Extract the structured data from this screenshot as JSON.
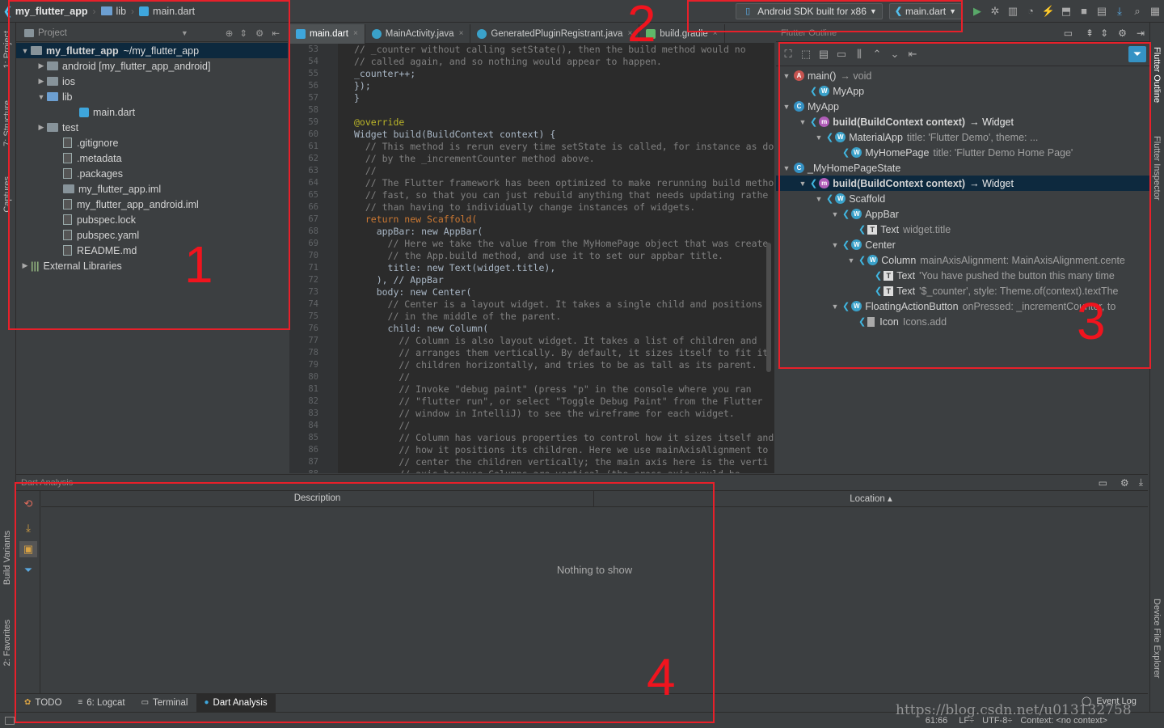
{
  "navbar": {
    "project": "my_flutter_app",
    "folder": "lib",
    "file": "main.dart",
    "device": "Android SDK built for x86",
    "config": "main.dart"
  },
  "project_panel": {
    "header": "Project",
    "tree": [
      {
        "label": "my_flutter_app",
        "detail": "~/my_flutter_app",
        "indent": 0,
        "arrow": "▼",
        "icon": "folder",
        "sel": true
      },
      {
        "label": "android [my_flutter_app_android]",
        "indent": 1,
        "arrow": "▶",
        "icon": "folder"
      },
      {
        "label": "ios",
        "indent": 1,
        "arrow": "▶",
        "icon": "folder"
      },
      {
        "label": "lib",
        "indent": 1,
        "arrow": "▼",
        "icon": "folder-blue"
      },
      {
        "label": "main.dart",
        "indent": 3,
        "arrow": "",
        "icon": "dart"
      },
      {
        "label": "test",
        "indent": 1,
        "arrow": "▶",
        "icon": "folder"
      },
      {
        "label": ".gitignore",
        "indent": 2,
        "arrow": "",
        "icon": "file"
      },
      {
        "label": ".metadata",
        "indent": 2,
        "arrow": "",
        "icon": "file"
      },
      {
        "label": ".packages",
        "indent": 2,
        "arrow": "",
        "icon": "file"
      },
      {
        "label": "my_flutter_app.iml",
        "indent": 2,
        "arrow": "",
        "icon": "folder"
      },
      {
        "label": "my_flutter_app_android.iml",
        "indent": 2,
        "arrow": "",
        "icon": "file"
      },
      {
        "label": "pubspec.lock",
        "indent": 2,
        "arrow": "",
        "icon": "file"
      },
      {
        "label": "pubspec.yaml",
        "indent": 2,
        "arrow": "",
        "icon": "file"
      },
      {
        "label": "README.md",
        "indent": 2,
        "arrow": "",
        "icon": "file"
      },
      {
        "label": "External Libraries",
        "indent": 0,
        "arrow": "▶",
        "icon": "lib"
      }
    ]
  },
  "editor": {
    "tabs": [
      {
        "label": "main.dart",
        "active": true
      },
      {
        "label": "MainActivity.java",
        "active": false
      },
      {
        "label": "GeneratedPluginRegistrant.java",
        "active": false
      },
      {
        "label": "build.gradle",
        "active": false
      }
    ],
    "line_numbers": [
      "53",
      "54",
      "55",
      "56",
      "57",
      "58",
      "59",
      "60",
      "61",
      "62",
      "63",
      "64",
      "65",
      "66",
      "67",
      "68",
      "69",
      "70",
      "71",
      "72",
      "73",
      "74",
      "75",
      "76",
      "77",
      "78",
      "79",
      "80",
      "81",
      "82",
      "83",
      "84",
      "85",
      "86",
      "87",
      "88"
    ],
    "lines": [
      {
        "text": "// _counter without calling setState(), then the build method would no",
        "cls": "comment"
      },
      {
        "text": "// called again, and so nothing would appear to happen.",
        "cls": "comment"
      },
      {
        "text": "_counter++;",
        "cls": ""
      },
      {
        "text": "});",
        "cls": ""
      },
      {
        "text": "}",
        "cls": ""
      },
      {
        "text": "",
        "cls": ""
      },
      {
        "text": "@override",
        "cls": "ann"
      },
      {
        "text": "Widget build(BuildContext context) {",
        "cls": ""
      },
      {
        "text": "  // This method is rerun every time setState is called, for instance as do",
        "cls": "comment"
      },
      {
        "text": "  // by the _incrementCounter method above.",
        "cls": "comment"
      },
      {
        "text": "  //",
        "cls": "comment"
      },
      {
        "text": "  // The Flutter framework has been optimized to make rerunning build metho",
        "cls": "comment"
      },
      {
        "text": "  // fast, so that you can just rebuild anything that needs updating rathe",
        "cls": "comment"
      },
      {
        "text": "  // than having to individually change instances of widgets.",
        "cls": "comment"
      },
      {
        "text": "  return new Scaffold(",
        "cls": "kw"
      },
      {
        "text": "    appBar: new AppBar(",
        "cls": ""
      },
      {
        "text": "      // Here we take the value from the MyHomePage object that was create",
        "cls": "comment"
      },
      {
        "text": "      // the App.build method, and use it to set our appbar title.",
        "cls": "comment"
      },
      {
        "text": "      title: new Text(widget.title),",
        "cls": ""
      },
      {
        "text": "    ), // AppBar",
        "cls": ""
      },
      {
        "text": "    body: new Center(",
        "cls": ""
      },
      {
        "text": "      // Center is a layout widget. It takes a single child and positions",
        "cls": "comment"
      },
      {
        "text": "      // in the middle of the parent.",
        "cls": "comment"
      },
      {
        "text": "      child: new Column(",
        "cls": ""
      },
      {
        "text": "        // Column is also layout widget. It takes a list of children and",
        "cls": "comment"
      },
      {
        "text": "        // arranges them vertically. By default, it sizes itself to fit it",
        "cls": "comment"
      },
      {
        "text": "        // children horizontally, and tries to be as tall as its parent.",
        "cls": "comment"
      },
      {
        "text": "        //",
        "cls": "comment"
      },
      {
        "text": "        // Invoke \"debug paint\" (press \"p\" in the console where you ran",
        "cls": "comment"
      },
      {
        "text": "        // \"flutter run\", or select \"Toggle Debug Paint\" from the Flutter",
        "cls": "comment"
      },
      {
        "text": "        // window in IntelliJ) to see the wireframe for each widget.",
        "cls": "comment"
      },
      {
        "text": "        //",
        "cls": "comment"
      },
      {
        "text": "        // Column has various properties to control how it sizes itself and",
        "cls": "comment"
      },
      {
        "text": "        // how it positions its children. Here we use mainAxisAlignment to",
        "cls": "comment"
      },
      {
        "text": "        // center the children vertically; the main axis here is the verti",
        "cls": "comment"
      },
      {
        "text": "        // axis because Columns are vertical (the cross axis would be",
        "cls": "comment"
      }
    ]
  },
  "outline": {
    "title": "Flutter Outline",
    "rows": [
      {
        "indent": 0,
        "arrow": "▼",
        "badge": "m",
        "label": "main()",
        "detail": "→ void"
      },
      {
        "indent": 1,
        "arrow": "",
        "badge": "w",
        "label": "MyApp",
        "detail": ""
      },
      {
        "indent": 0,
        "arrow": "▼",
        "badge": "c",
        "label": "MyApp",
        "detail": ""
      },
      {
        "indent": 1,
        "arrow": "▼",
        "badge": "m2",
        "label": "build(BuildContext context)",
        "detail": "→ Widget"
      },
      {
        "indent": 2,
        "arrow": "▼",
        "badge": "w",
        "label": "MaterialApp",
        "detail": "title: 'Flutter Demo', theme: ..."
      },
      {
        "indent": 3,
        "arrow": "",
        "badge": "w",
        "label": "MyHomePage",
        "detail": "title: 'Flutter Demo Home Page'"
      },
      {
        "indent": 0,
        "arrow": "▼",
        "badge": "c",
        "label": "_MyHomePageState",
        "detail": ""
      },
      {
        "indent": 1,
        "arrow": "▼",
        "badge": "m2",
        "label": "build(BuildContext context)",
        "detail": "→ Widget",
        "sel": true
      },
      {
        "indent": 2,
        "arrow": "▼",
        "badge": "w",
        "label": "Scaffold",
        "detail": ""
      },
      {
        "indent": 3,
        "arrow": "▼",
        "badge": "w",
        "label": "AppBar",
        "detail": ""
      },
      {
        "indent": 4,
        "arrow": "",
        "badge": "t",
        "label": "Text",
        "detail": "widget.title"
      },
      {
        "indent": 3,
        "arrow": "▼",
        "badge": "w",
        "label": "Center",
        "detail": ""
      },
      {
        "indent": 4,
        "arrow": "▼",
        "badge": "w",
        "label": "Column",
        "detail": "mainAxisAlignment: MainAxisAlignment.cente"
      },
      {
        "indent": 5,
        "arrow": "",
        "badge": "t",
        "label": "Text",
        "detail": "'You have pushed the button this many time"
      },
      {
        "indent": 5,
        "arrow": "",
        "badge": "t",
        "label": "Text",
        "detail": "'$_counter', style: Theme.of(context).textThe"
      },
      {
        "indent": 3,
        "arrow": "▼",
        "badge": "w",
        "label": "FloatingActionButton",
        "detail": "onPressed: _incrementCounter, to"
      },
      {
        "indent": 4,
        "arrow": "",
        "badge": "i",
        "label": "Icon",
        "detail": "Icons.add"
      }
    ]
  },
  "analysis": {
    "title": "Dart Analysis",
    "col_description": "Description",
    "col_location": "Location ▴",
    "empty": "Nothing to show"
  },
  "bottom_tabs": [
    {
      "label": "TODO",
      "active": false
    },
    {
      "label": "6: Logcat",
      "active": false
    },
    {
      "label": "Terminal",
      "active": false
    },
    {
      "label": "Dart Analysis",
      "active": true
    }
  ],
  "event_log": "Event Log",
  "status": {
    "position": "61:66",
    "line_sep": "LF÷",
    "encoding": "UTF-8÷",
    "context": "Context: <no context>"
  },
  "watermark": "https://blog.csdn.net/u013132758",
  "left_stripe": [
    "1: Project",
    "7: Structure",
    "Captures",
    "Build Variants",
    "2: Favorites"
  ],
  "right_stripe": [
    "Flutter Outline",
    "Flutter Inspector",
    "Device File Explorer"
  ],
  "annotations": [
    "1",
    "2",
    "3",
    "4"
  ]
}
